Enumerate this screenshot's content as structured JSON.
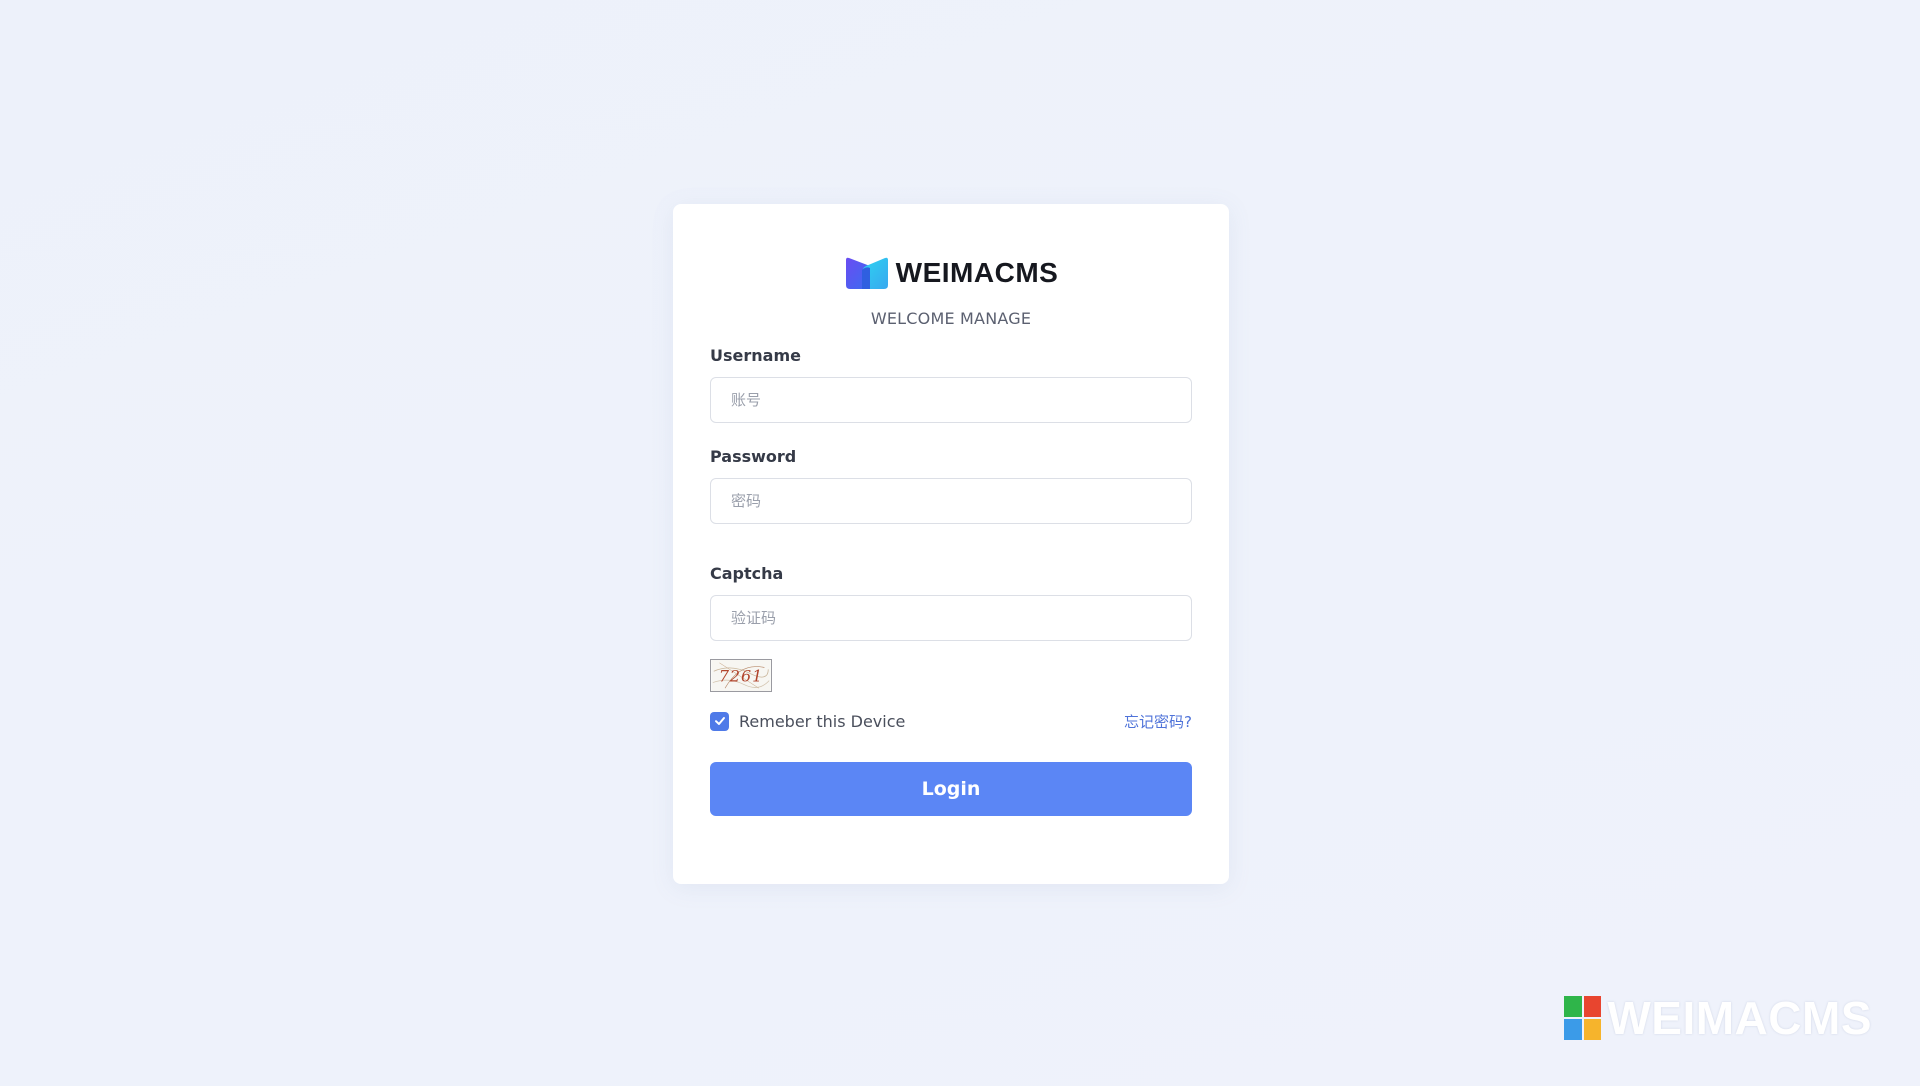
{
  "brand": {
    "name": "WEIMACMS",
    "subtitle": "WELCOME MANAGE",
    "logo_colors": [
      "#5b4ef0",
      "#3b82f6",
      "#22d3ee"
    ]
  },
  "form": {
    "username": {
      "label": "Username",
      "placeholder": "账号",
      "value": ""
    },
    "password": {
      "label": "Password",
      "placeholder": "密码",
      "value": ""
    },
    "captcha": {
      "label": "Captcha",
      "placeholder": "验证码",
      "value": "",
      "image_text": "7261"
    },
    "remember": {
      "label": "Remeber this Device",
      "checked": true
    },
    "forgot_link": "忘记密码?",
    "login_button": "Login"
  },
  "watermark": {
    "text": "WEIMACMS",
    "tile_colors": [
      "#2fb54a",
      "#e8452f",
      "#3b9be8",
      "#f6b42c"
    ]
  },
  "colors": {
    "accent": "#5b86f5",
    "checkbox": "#4f7ae8",
    "link": "#4f73d9",
    "background": "#eef2fb"
  }
}
